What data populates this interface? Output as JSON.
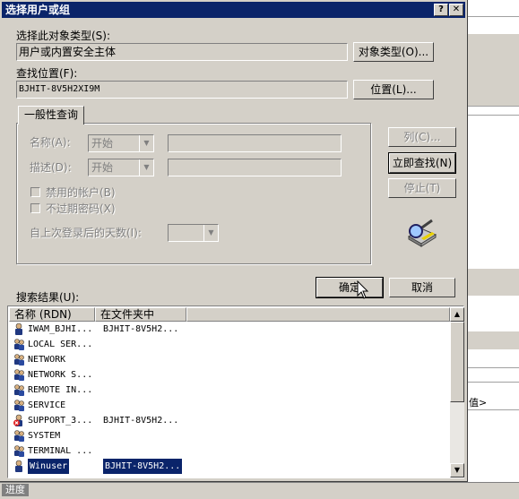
{
  "dialog": {
    "title": "选择用户或组",
    "help_btn": "?",
    "close_btn": "✕",
    "object_type_label": "选择此对象类型(S):",
    "object_type_value": "用户或内置安全主体",
    "object_type_btn": "对象类型(O)...",
    "location_label": "查找位置(F):",
    "location_value": "BJHIT-8V5H2XI9M",
    "location_btn": "位置(L)...",
    "tab_label": "一般性查询",
    "name_label": "名称(A):",
    "name_mode": "开始",
    "desc_label": "描述(D):",
    "desc_mode": "开始",
    "disabled_accounts": "禁用的帐户(B)",
    "non_expiring_pw": "不过期密码(X)",
    "days_since_login": "自上次登录后的天数(I):",
    "columns_btn": "列(C)...",
    "find_now_btn": "立即查找(N)",
    "stop_btn": "停止(T)",
    "results_label": "搜索结果(U):",
    "ok_btn": "确定",
    "cancel_btn": "取消"
  },
  "results": {
    "columns": [
      "名称 (RDN)",
      "在文件夹中"
    ],
    "rows": [
      {
        "name": "IWAM_BJHI...",
        "folder": "BJHIT-8V5H2...",
        "icon": "user-icon"
      },
      {
        "name": "LOCAL SER...",
        "folder": "",
        "icon": "group-icon"
      },
      {
        "name": "NETWORK",
        "folder": "",
        "icon": "group-icon"
      },
      {
        "name": "NETWORK S...",
        "folder": "",
        "icon": "group-icon"
      },
      {
        "name": "REMOTE IN...",
        "folder": "",
        "icon": "group-icon"
      },
      {
        "name": "SERVICE",
        "folder": "",
        "icon": "group-icon"
      },
      {
        "name": "SUPPORT_3...",
        "folder": "BJHIT-8V5H2...",
        "icon": "disabled-user-icon"
      },
      {
        "name": "SYSTEM",
        "folder": "",
        "icon": "group-icon"
      },
      {
        "name": "TERMINAL ...",
        "folder": "",
        "icon": "group-icon"
      },
      {
        "name": "Winuser",
        "folder": "BJHIT-8V5H2...",
        "icon": "user-icon",
        "selected": true
      }
    ]
  },
  "background": {
    "right_text": "值>",
    "bottom_label": "进度"
  },
  "colors": {
    "title_bar": "#0a246a",
    "face": "#d4d0c8",
    "selection": "#0a246a"
  }
}
